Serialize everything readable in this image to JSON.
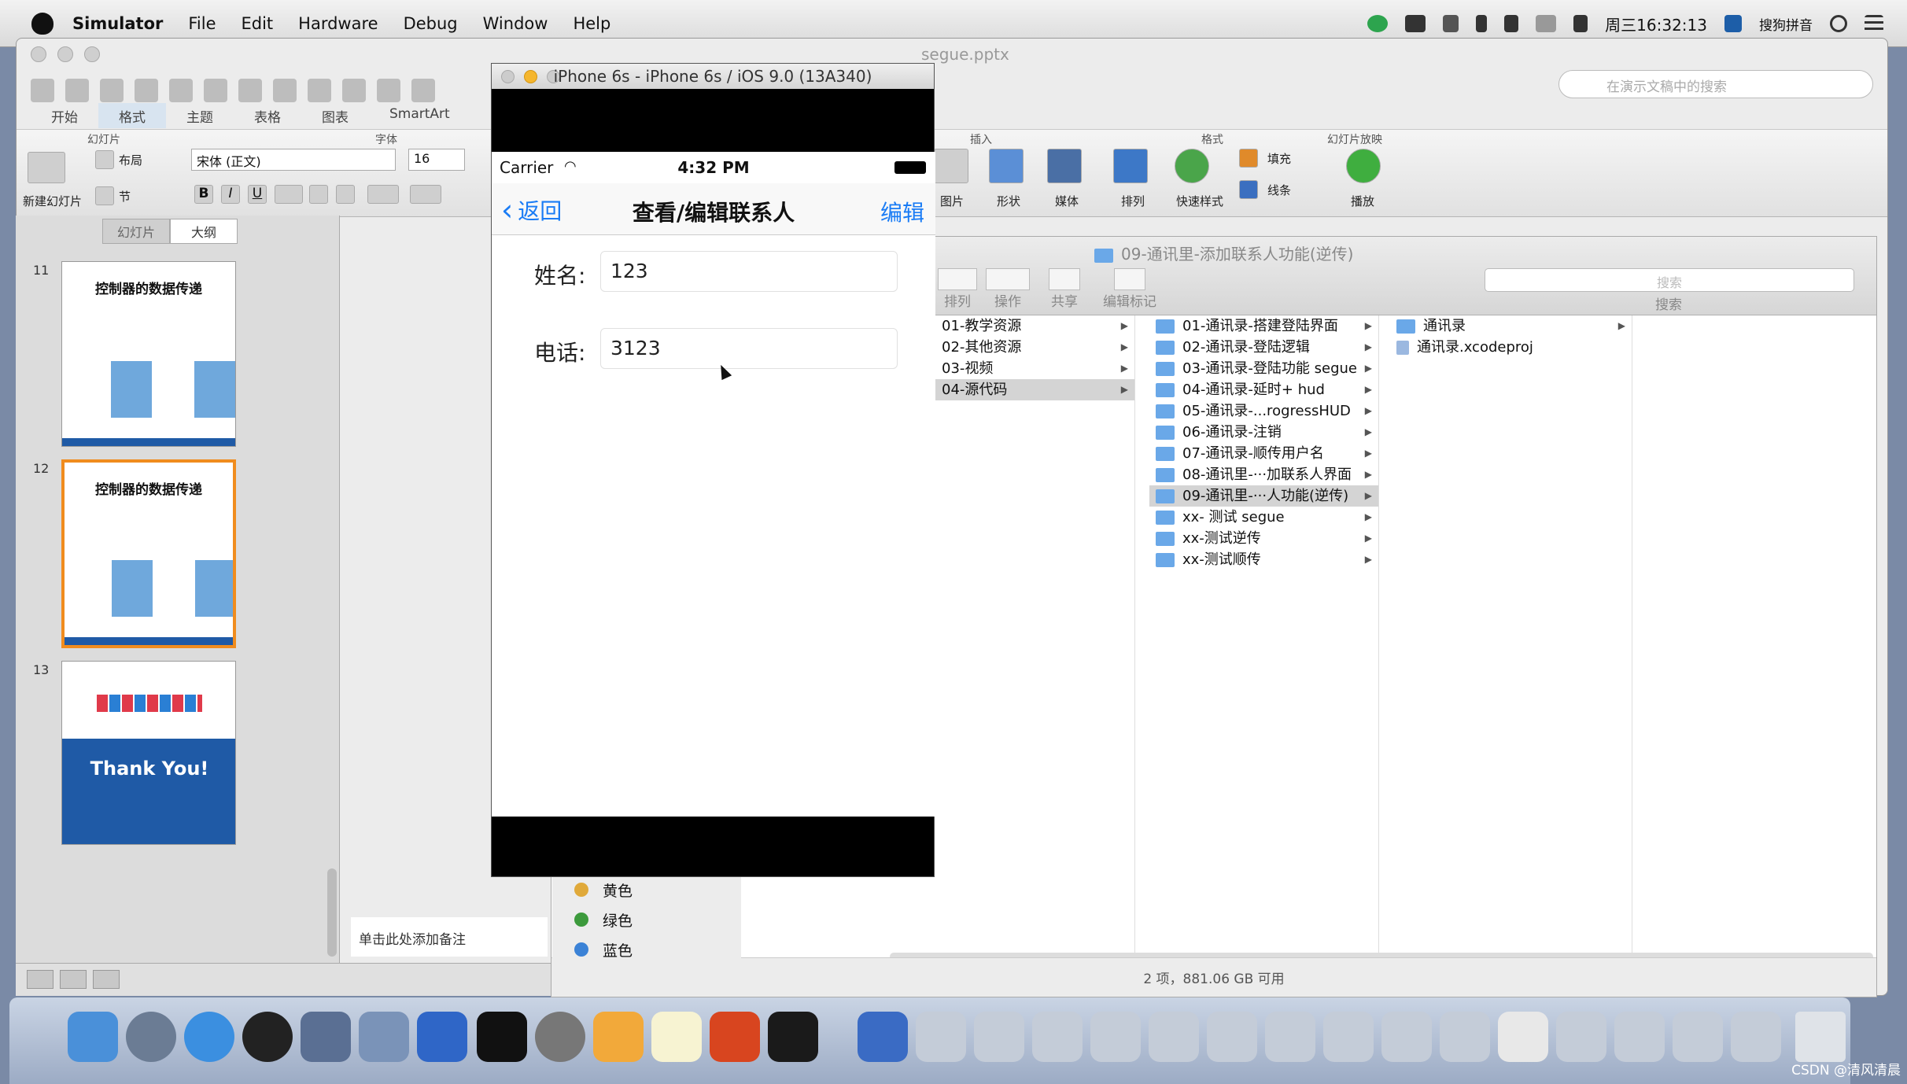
{
  "menubar": {
    "app": "Simulator",
    "items": [
      "File",
      "Edit",
      "Hardware",
      "Debug",
      "Window",
      "Help"
    ],
    "clock": "周三16:32:13",
    "input_method": "搜狗拼音"
  },
  "ppt": {
    "title": "segue.pptx",
    "search_placeholder": "在演示文稿中的搜索",
    "tabs": [
      "开始",
      "格式",
      "主题",
      "表格",
      "图表",
      "SmartArt"
    ],
    "groups": {
      "slides": "幻灯片",
      "font": "字体",
      "insert": "插入",
      "format": "格式",
      "slideshow": "幻灯片放映"
    },
    "new_slide": "新建幻灯片",
    "layout": "布局",
    "section": "节",
    "font_name": "宋体 (正文)",
    "font_size": "16",
    "insert_items": [
      "图片",
      "形状",
      "媒体"
    ],
    "format_items": [
      "排列",
      "快速样式"
    ],
    "fill": "填充",
    "line": "线条",
    "play": "播放",
    "panel_tabs": [
      "幻灯片",
      "大纲"
    ],
    "slides": [
      {
        "num": "11",
        "title": "控制器的数据传递"
      },
      {
        "num": "12",
        "title": "控制器的数据传递"
      },
      {
        "num": "13",
        "title": "Thank You!"
      }
    ],
    "notes": "单击此处添加备注",
    "colors": [
      {
        "name": "黄色",
        "hex": "#e0a93a"
      },
      {
        "name": "绿色",
        "hex": "#3c9a3c"
      },
      {
        "name": "蓝色",
        "hex": "#3b82d6"
      }
    ]
  },
  "finder": {
    "title": "09-通讯里-添加联系人功能(逆传)",
    "toolbar": [
      "排列",
      "操作",
      "共享",
      "编辑标记"
    ],
    "search_placeholder": "搜索",
    "search_label": "搜索",
    "col1": [
      "01-教学资源",
      "02-其他资源",
      "03-视频",
      "04-源代码"
    ],
    "col2": [
      "01-通讯录-搭建登陆界面",
      "02-通讯录-登陆逻辑",
      "03-通讯录-登陆功能 segue",
      "04-通讯录-延时+ hud",
      "05-通讯录-...rogressHUD",
      "06-通讯录-注销",
      "07-通讯录-顺传用户名",
      "08-通讯里-···加联系人界面",
      "09-通讯里-···人功能(逆传)",
      "xx- 测试 segue",
      "xx-测试逆传",
      "xx-测试顺传"
    ],
    "col3": [
      "通讯录",
      "通讯录.xcodeproj"
    ],
    "status": "2 项，881.06 GB 可用"
  },
  "simulator": {
    "title": "iPhone 6s - iPhone 6s / iOS 9.0 (13A340)",
    "carrier": "Carrier",
    "time": "4:32 PM",
    "back": "返回",
    "nav_title": "查看/编辑联系人",
    "edit": "编辑",
    "name_label": "姓名:",
    "name_value": "123",
    "phone_label": "电话:",
    "phone_value": "3123"
  },
  "credit": "CSDN @清风清晨"
}
